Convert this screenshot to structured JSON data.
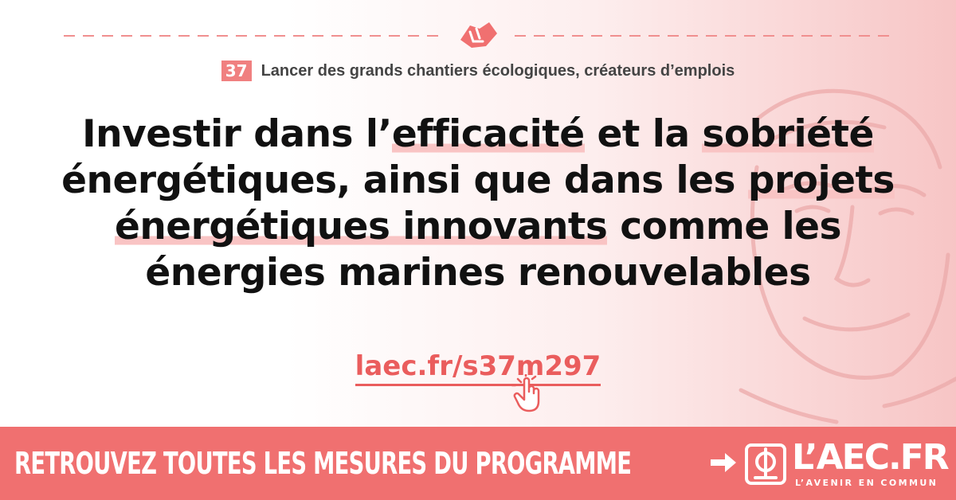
{
  "chapter": {
    "number": "37",
    "title": "Lancer des grands chantiers écologiques, créateurs d’emplois"
  },
  "headline": {
    "p1": "Investir dans l’",
    "h1": "efficacité",
    "p2": " et la ",
    "h2": "sobriété",
    "p3": " énergétiques, ainsi que dans les ",
    "h3": "projets énergétiques innovants",
    "p4": " comme les énergies marines renouvelables"
  },
  "link": {
    "text": "laec.fr/s37m297"
  },
  "footer": {
    "cta": "RETROUVEZ TOUTES LES MESURES DU PROGRAMME",
    "brand": "L’AEC.FR",
    "tagline": "L’AVENIR EN COMMUN"
  },
  "colors": {
    "accent": "#f07070",
    "highlight": "#f9c4c4",
    "link": "#ea5d5d",
    "text": "#111111"
  },
  "icons": [
    "handshake-icon",
    "pointer-hand-icon",
    "arrow-right-icon",
    "phi-logo-icon",
    "portrait-image"
  ]
}
